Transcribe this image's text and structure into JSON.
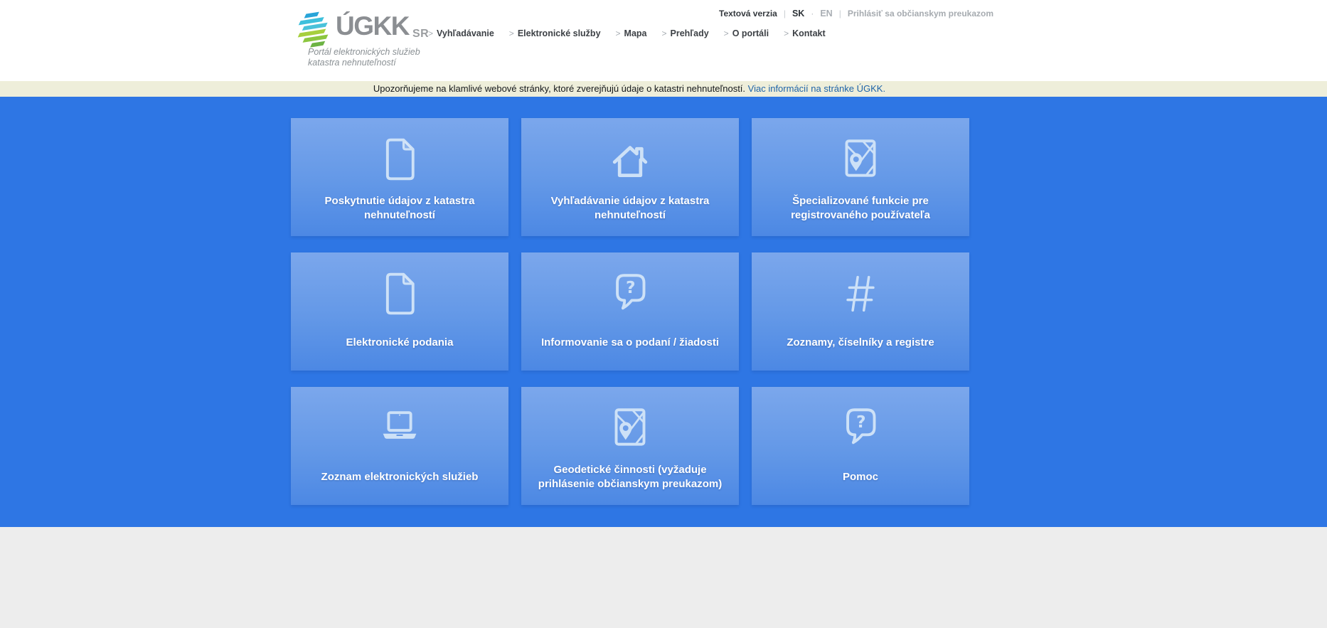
{
  "header": {
    "logo": {
      "acronym": "ÚGKK",
      "suffix": "SR",
      "tagline_line1": "Portál elektronických služieb",
      "tagline_line2": "katastra nehnuteľností"
    },
    "utility": {
      "text_version": "Textová verzia",
      "separator": "|",
      "lang_sk": "SK",
      "lang_separator": "·",
      "lang_en": "EN",
      "login": "Prihlásiť sa občianskym preukazom"
    },
    "nav_chevron": ">",
    "nav_items": [
      {
        "label": "Vyhľadávanie"
      },
      {
        "label": "Elektronické služby"
      },
      {
        "label": "Mapa"
      },
      {
        "label": "Prehľady"
      },
      {
        "label": "O portáli"
      },
      {
        "label": "Kontakt"
      }
    ]
  },
  "banner": {
    "text": "Upozorňujeme na klamlivé webové stránky, ktoré zverejňujú údaje o katastri nehnuteľností.",
    "link_text": "Viac informácií na stránke ÚGKK."
  },
  "tiles": [
    {
      "label": "Poskytnutie údajov z katastra nehnuteľností",
      "icon": "document-icon"
    },
    {
      "label": "Vyhľadávanie údajov z katastra nehnuteľností",
      "icon": "house-icon"
    },
    {
      "label": "Špecializované funkcie pre registrovaného používateľa",
      "icon": "map-pin-icon"
    },
    {
      "label": "Elektronické podania",
      "icon": "document-icon"
    },
    {
      "label": "Informovanie sa o podaní / žiadosti",
      "icon": "question-bubble-icon"
    },
    {
      "label": "Zoznamy, číselníky a registre",
      "icon": "hash-icon"
    },
    {
      "label": "Zoznam elektronických služieb",
      "icon": "laptop-icon"
    },
    {
      "label": "Geodetické činnosti (vyžaduje prihlásenie občianskym preukazom)",
      "icon": "map-pin-icon"
    },
    {
      "label": "Pomoc",
      "icon": "question-bubble-icon"
    }
  ],
  "colors": {
    "main_background": "#2e76e4",
    "tile_gradient_top": "#7ba7ec",
    "tile_gradient_bottom": "#4c88e4",
    "tile_icon": "#cde1f7",
    "banner_background": "#eeeeda",
    "banner_link": "#1f64a8",
    "footer_background": "#ededed",
    "logo_gray": "#8b8e92",
    "logo_stripe_blues": [
      "#29a4d8",
      "#3ec0dc",
      "#4ac2da"
    ],
    "logo_stripe_greens": [
      "#a6cf3d",
      "#8cc63f",
      "#6db344"
    ]
  }
}
